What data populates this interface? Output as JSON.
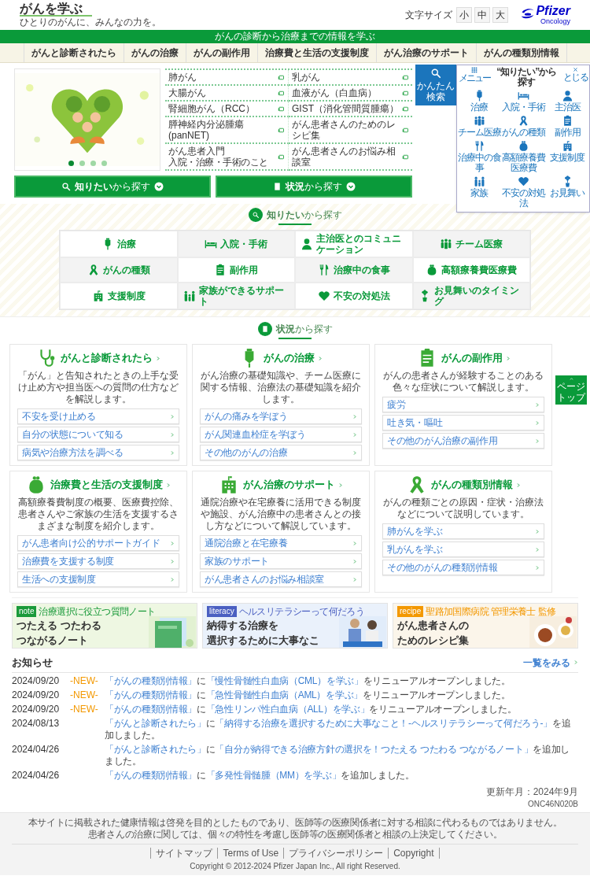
{
  "header": {
    "logo": "がんを学ぶ",
    "logo_tagline": "ひとりのがんに、みんなの力を。",
    "font_size_label": "文字サイズ",
    "font_sizes": [
      "小",
      "中",
      "大"
    ],
    "brand": "Pfizer",
    "brand_sub": "Oncology"
  },
  "tagline": "がんの診断から治療までの情報を学ぶ",
  "nav": [
    "がんと診断されたら",
    "がんの治療",
    "がんの副作用",
    "治療費と生活の支援制度",
    "がん治療のサポート",
    "がんの種類別情報"
  ],
  "hero": {
    "kind": "picture",
    "slides": [
      {
        "selected": true
      },
      {
        "selected": false
      },
      {
        "selected": false
      },
      {
        "selected": false
      }
    ]
  },
  "cancer_links": [
    {
      "label": "肺がん"
    },
    {
      "label": "乳がん"
    },
    {
      "label": "大腸がん"
    },
    {
      "label": "血液がん（白血病）"
    },
    {
      "label": "腎細胞がん（RCC）"
    },
    {
      "label": "GIST（消化管間質腫瘍）"
    },
    {
      "label": "膵神経内分泌腫瘍(panNET)"
    },
    {
      "label": "がん患者さんのためのレシピ集"
    },
    {
      "label": "がん患者入門",
      "note": "入院・治療・手術のこと"
    },
    {
      "label": "がん患者さんのお悩み相談室"
    }
  ],
  "search_buttons": [
    "**知りたい**から探す",
    "**状況**から探す"
  ],
  "topics_section": {
    "title": "**知りたい**から探す",
    "items": [
      "治療",
      "入院・手術",
      "主治医とのコミュニケーション",
      "チーム医療",
      "がんの種類",
      "副作用",
      "治療中の食事",
      "高額療養費医療費",
      "支援制度",
      "家族ができるサポート",
      "不安の対処法",
      "お見舞いのタイミング"
    ]
  },
  "situations_section": {
    "title": "**状況**から探す",
    "cards": [
      {
        "title": "がんと診断されたら",
        "description": "「がん」と告知されたときの上手な受け止め方や担当医への質問の仕方などを解説します。",
        "links": [
          "不安を受け止める",
          "自分の状態について知る",
          "病気や治療方法を調べる"
        ]
      },
      {
        "title": "がんの治療",
        "description": "がん治療の基礎知識や、チーム医療に関する情報、治療法の基礎知識を紹介します。",
        "links": [
          "がんの痛みを学ぼう",
          "がん関連血栓症を学ぼう",
          "その他のがんの治療"
        ]
      },
      {
        "title": "がんの副作用",
        "description": "がんの患者さんが経験することのある色々な症状について解説します。",
        "links": [
          "疲労",
          "吐き気・嘔吐",
          "その他のがん治療の副作用"
        ]
      },
      {
        "title": "治療費と生活の支援制度",
        "description": "高額療養費制度の概要、医療費控除、患者さんやご家族の生活を支援するさまざまな制度を紹介します。",
        "links": [
          "がん患者向け公的サポートガイド",
          "治療費を支援する制度",
          "生活への支援制度"
        ]
      },
      {
        "title": "がん治療のサポート",
        "description": "通院治療や在宅療養に活用できる制度や施設、がん治療中の患者さんとの接し方などについて解説しています。",
        "links": [
          "通院治療と在宅療養",
          "家族のサポート",
          "がん患者さんのお悩み相談室"
        ]
      },
      {
        "title": "がんの種類別情報",
        "description": "がんの種類ごとの原因・症状・治療法などについて説明しています。",
        "links": [
          "肺がんを学ぶ",
          "乳がんを学ぶ",
          "その他のがんの種類別情報"
        ]
      }
    ]
  },
  "page_top": "ページトップ",
  "banners": [
    {
      "tag": "note",
      "color": "#1a9a3a",
      "subtitle": "治療選択に役立つ質問ノート",
      "title_lines": [
        "つたえる つたわる",
        "つながるノート"
      ]
    },
    {
      "tag": "literacy",
      "color": "#4a5fc1",
      "subtitle": "ヘルスリテラシーって何だろう",
      "title_lines": [
        "納得する治療を",
        "選択するために大事なこ"
      ]
    },
    {
      "tag": "recipe",
      "color": "#f39800",
      "subtitle": "聖路加国際病院 管理栄養士 監修",
      "title_lines": [
        "がん患者さんの",
        "ためのレシピ集"
      ]
    }
  ],
  "news": {
    "title": "お知らせ",
    "more": "一覧をみる",
    "items": [
      {
        "date": "2024/09/20",
        "badge": "-NEW-",
        "section": "「がんの種類別情報」",
        "joiner": "に",
        "link": "「慢性骨髄性白血病（CML）を学ぶ」",
        "action": "をリニューアルオープンしました。"
      },
      {
        "date": "2024/09/20",
        "badge": "-NEW-",
        "section": "「がんの種類別情報」",
        "joiner": "に",
        "link": "「急性骨髄性白血病（AML）を学ぶ」",
        "action": "をリニューアルオープンしました。"
      },
      {
        "date": "2024/09/20",
        "badge": "-NEW-",
        "section": "「がんの種類別情報」",
        "joiner": "に",
        "link": "「急性リンパ性白血病（ALL）を学ぶ」",
        "action": "をリニューアルオープンしました。"
      },
      {
        "date": "2024/08/13",
        "section": "「がんと診断されたら」",
        "joiner": "に",
        "link": "「納得する治療を選択するために大事なこと！-ヘルスリテラシーって何だろう-」",
        "action": "を追加しました。"
      },
      {
        "date": "2024/04/26",
        "section": "「がんと診断されたら」",
        "joiner": "に",
        "link": "「自分が納得できる治療方針の選択を！つたえる つたわる つながるノート」",
        "action": "を追加しました。"
      },
      {
        "date": "2024/04/26",
        "section": "「がんの種類別情報」",
        "joiner": "に",
        "link": "「多発性骨髄腫（MM）を学ぶ」",
        "action": "を追加しました。"
      }
    ]
  },
  "updated": "更新年月：2024年9月",
  "code": "ONC46N020B",
  "footer": {
    "disclaimer": [
      "本サイトに掲載された健康情報は啓発を目的としたものであり、医師等の医療関係者に対する相談に代わるものではありません。",
      "患者さんの治療に関しては、個々の特性を考慮し医師等の医療関係者と相談の上決定してください。"
    ],
    "links": [
      "サイトマップ",
      "Terms of Use",
      "プライバシーポリシー",
      "Copyright"
    ],
    "copyright": "Copyright © 2012-2024 Pfizer Japan Inc., All right Reserved."
  },
  "quick_panel": {
    "tab": "かんたん検索",
    "menu": "メニュー",
    "title": "“知りたい”から探す",
    "close": "とじる",
    "items": [
      "治療",
      "入院・手術",
      "主治医",
      "チーム医療",
      "がんの種類",
      "副作用",
      "治療中の食事",
      "高額療養費医療費",
      "支援制度",
      "家族",
      "不安の対処法",
      "お見舞い"
    ]
  }
}
